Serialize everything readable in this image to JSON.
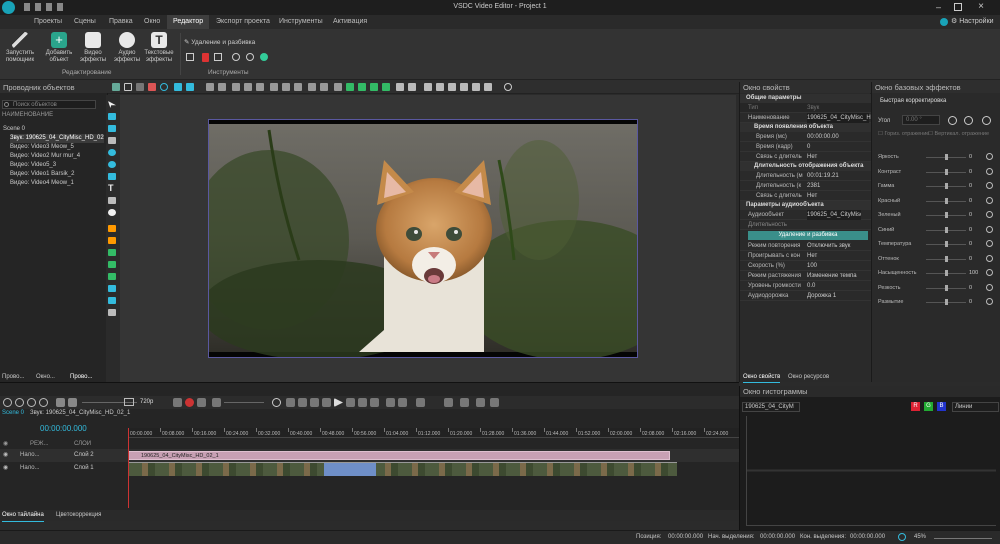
{
  "titlebar": {
    "title": "VSDC Video Editor - Project 1",
    "settings_label": "Настройки"
  },
  "menu": {
    "items": [
      "Проекты",
      "Сцены",
      "Правка",
      "Окно",
      "Редактор",
      "Экспорт проекта",
      "Инструменты",
      "Активация"
    ],
    "active_index": 4
  },
  "ribbon": {
    "buttons": [
      {
        "label": "Запустить помощник",
        "icon": "wand-icon"
      },
      {
        "label": "Добавить объект",
        "icon": "add-object-icon"
      },
      {
        "label": "Видео эффекты",
        "icon": "video-effects-icon"
      },
      {
        "label": "Аудио эффекты",
        "icon": "audio-effects-icon"
      },
      {
        "label": "Текстовые эффекты",
        "icon": "text-effects-icon"
      }
    ],
    "group_editing": "Редактирование",
    "tools_header": "Удаление и разбивка",
    "group_tools": "Инструменты"
  },
  "explorer": {
    "title": "Проводник объектов",
    "search_placeholder": "Поиск объектов",
    "column_header": "НАИМЕНОВАНИЕ",
    "items": [
      "Scene 0",
      "Звук: 190625_04_CityMisc_HD_02",
      "Видео: Video3 Meow_5",
      "Видео: Video2 Mur mur_4",
      "Видео: Video5_3",
      "Видео: Video1 Barsik_2",
      "Видео: Video4 Meow_1"
    ],
    "bottom_tabs": [
      "Прово...",
      "Окно...",
      "Прово..."
    ]
  },
  "properties": {
    "title": "Окно свойств",
    "col_type": "Тип",
    "col_sound": "Звук",
    "sections": {
      "general": "Общие параметры",
      "appearance": "Время появления объекта",
      "duration": "Длительность отображения объекта",
      "audio": "Параметры аудиообъекта"
    },
    "rows": {
      "name": {
        "k": "Наименование",
        "v": "190625_04_CityMisc_H"
      },
      "time_ms": {
        "k": "Время (мс)",
        "v": "00:00:00.00"
      },
      "time_frame": {
        "k": "Время (кадр)",
        "v": "0"
      },
      "link_len": {
        "k": "Связь с длитель",
        "v": "Нет"
      },
      "dur_ms": {
        "k": "Длительность (м",
        "v": "00:01:19.21"
      },
      "dur_frames": {
        "k": "Длительность (к",
        "v": "2381"
      },
      "link_len2": {
        "k": "Связь с длитель",
        "v": "Нет"
      },
      "audio_obj": {
        "k": "Аудиообъект",
        "v": "190625_04_CityMisc"
      },
      "length": {
        "k": "Длительность",
        "v": ""
      },
      "repeat": {
        "k": "Режим повторения",
        "v": "Отключить звук"
      },
      "reverse": {
        "k": "Проигрывать с кон",
        "v": "Нет"
      },
      "speed": {
        "k": "Скорость (%)",
        "v": "100"
      },
      "stretch": {
        "k": "Режим растяжения",
        "v": "Изменение темпа"
      },
      "volume": {
        "k": "Уровень громкости",
        "v": "0.0"
      },
      "track": {
        "k": "Аудиодорожка",
        "v": "Дорожка 1"
      }
    },
    "split_button": "Удаление и разбивка",
    "tabs": [
      "Окно свойств",
      "Окно ресурсов"
    ]
  },
  "effects": {
    "title": "Окно базовых эффектов",
    "section": "Быстрая корректировка",
    "angle_label": "Угол",
    "angle_value": "0.00 °",
    "flip_h": "Гориз. отражение",
    "flip_v": "Вертикал. отражение",
    "sliders": [
      {
        "label": "Яркость",
        "value": "0",
        "pos": 0.5
      },
      {
        "label": "Контраст",
        "value": "0",
        "pos": 0.5
      },
      {
        "label": "Гамма",
        "value": "0",
        "pos": 0.5
      },
      {
        "label": "Красный",
        "value": "0",
        "pos": 0.5
      },
      {
        "label": "Зеленый",
        "value": "0",
        "pos": 0.5
      },
      {
        "label": "Синий",
        "value": "0",
        "pos": 0.5
      },
      {
        "label": "Температура",
        "value": "0",
        "pos": 0.5
      },
      {
        "label": "Оттенок",
        "value": "0",
        "pos": 0.5
      },
      {
        "label": "Насыщенность",
        "value": "100",
        "pos": 0.5
      },
      {
        "label": "Резкость",
        "value": "0",
        "pos": 0.5
      },
      {
        "label": "Размытие",
        "value": "0",
        "pos": 0.5
      }
    ]
  },
  "timeline": {
    "resolution": "720p",
    "scene_tab": "Scene 0",
    "clip_tab": "Звук: 190625_04_CityMisc_HD_02_1",
    "timecode": "00:00:00.000",
    "layers_header": "СЛОИ",
    "mode_header": "РЕЖ...",
    "tracks": [
      {
        "mode": "Нало...",
        "name": "Слой 2"
      },
      {
        "mode": "Нало...",
        "name": "Слой 1"
      }
    ],
    "audio_clip_label": "190625_04_CityMisc_HD_02_1",
    "ruler": [
      "00:00.000",
      "00:08.000",
      "00:16.000",
      "00:24.000",
      "00:32.000",
      "00:40.000",
      "00:48.000",
      "00:56.000",
      "01:04.000",
      "01:12.000",
      "01:20.000",
      "01:28.000",
      "01:36.000",
      "01:44.000",
      "01:52.000",
      "02:00.000",
      "02:08.000",
      "02:16.000",
      "02:24.000"
    ],
    "bottom_tabs": [
      "Окно тайлайна",
      "Цветокоррекция"
    ]
  },
  "histogram": {
    "title": "Окно гистограммы",
    "source": "190625_04_CityM",
    "mode": "Линии",
    "channels": [
      "R",
      "G",
      "B"
    ]
  },
  "status": {
    "position_label": "Позиция:",
    "position_value": "00:00:00.000",
    "sel_start_label": "Нач. выделения:",
    "sel_start_value": "00:00:00.000",
    "sel_end_label": "Кон. выделения:",
    "sel_end_value": "00:00:00.000",
    "zoom": "45%"
  },
  "colors": {
    "accent": "#00b4b4",
    "audio_clip": "#c8a0b4",
    "split_button": "#3a8f8a"
  }
}
